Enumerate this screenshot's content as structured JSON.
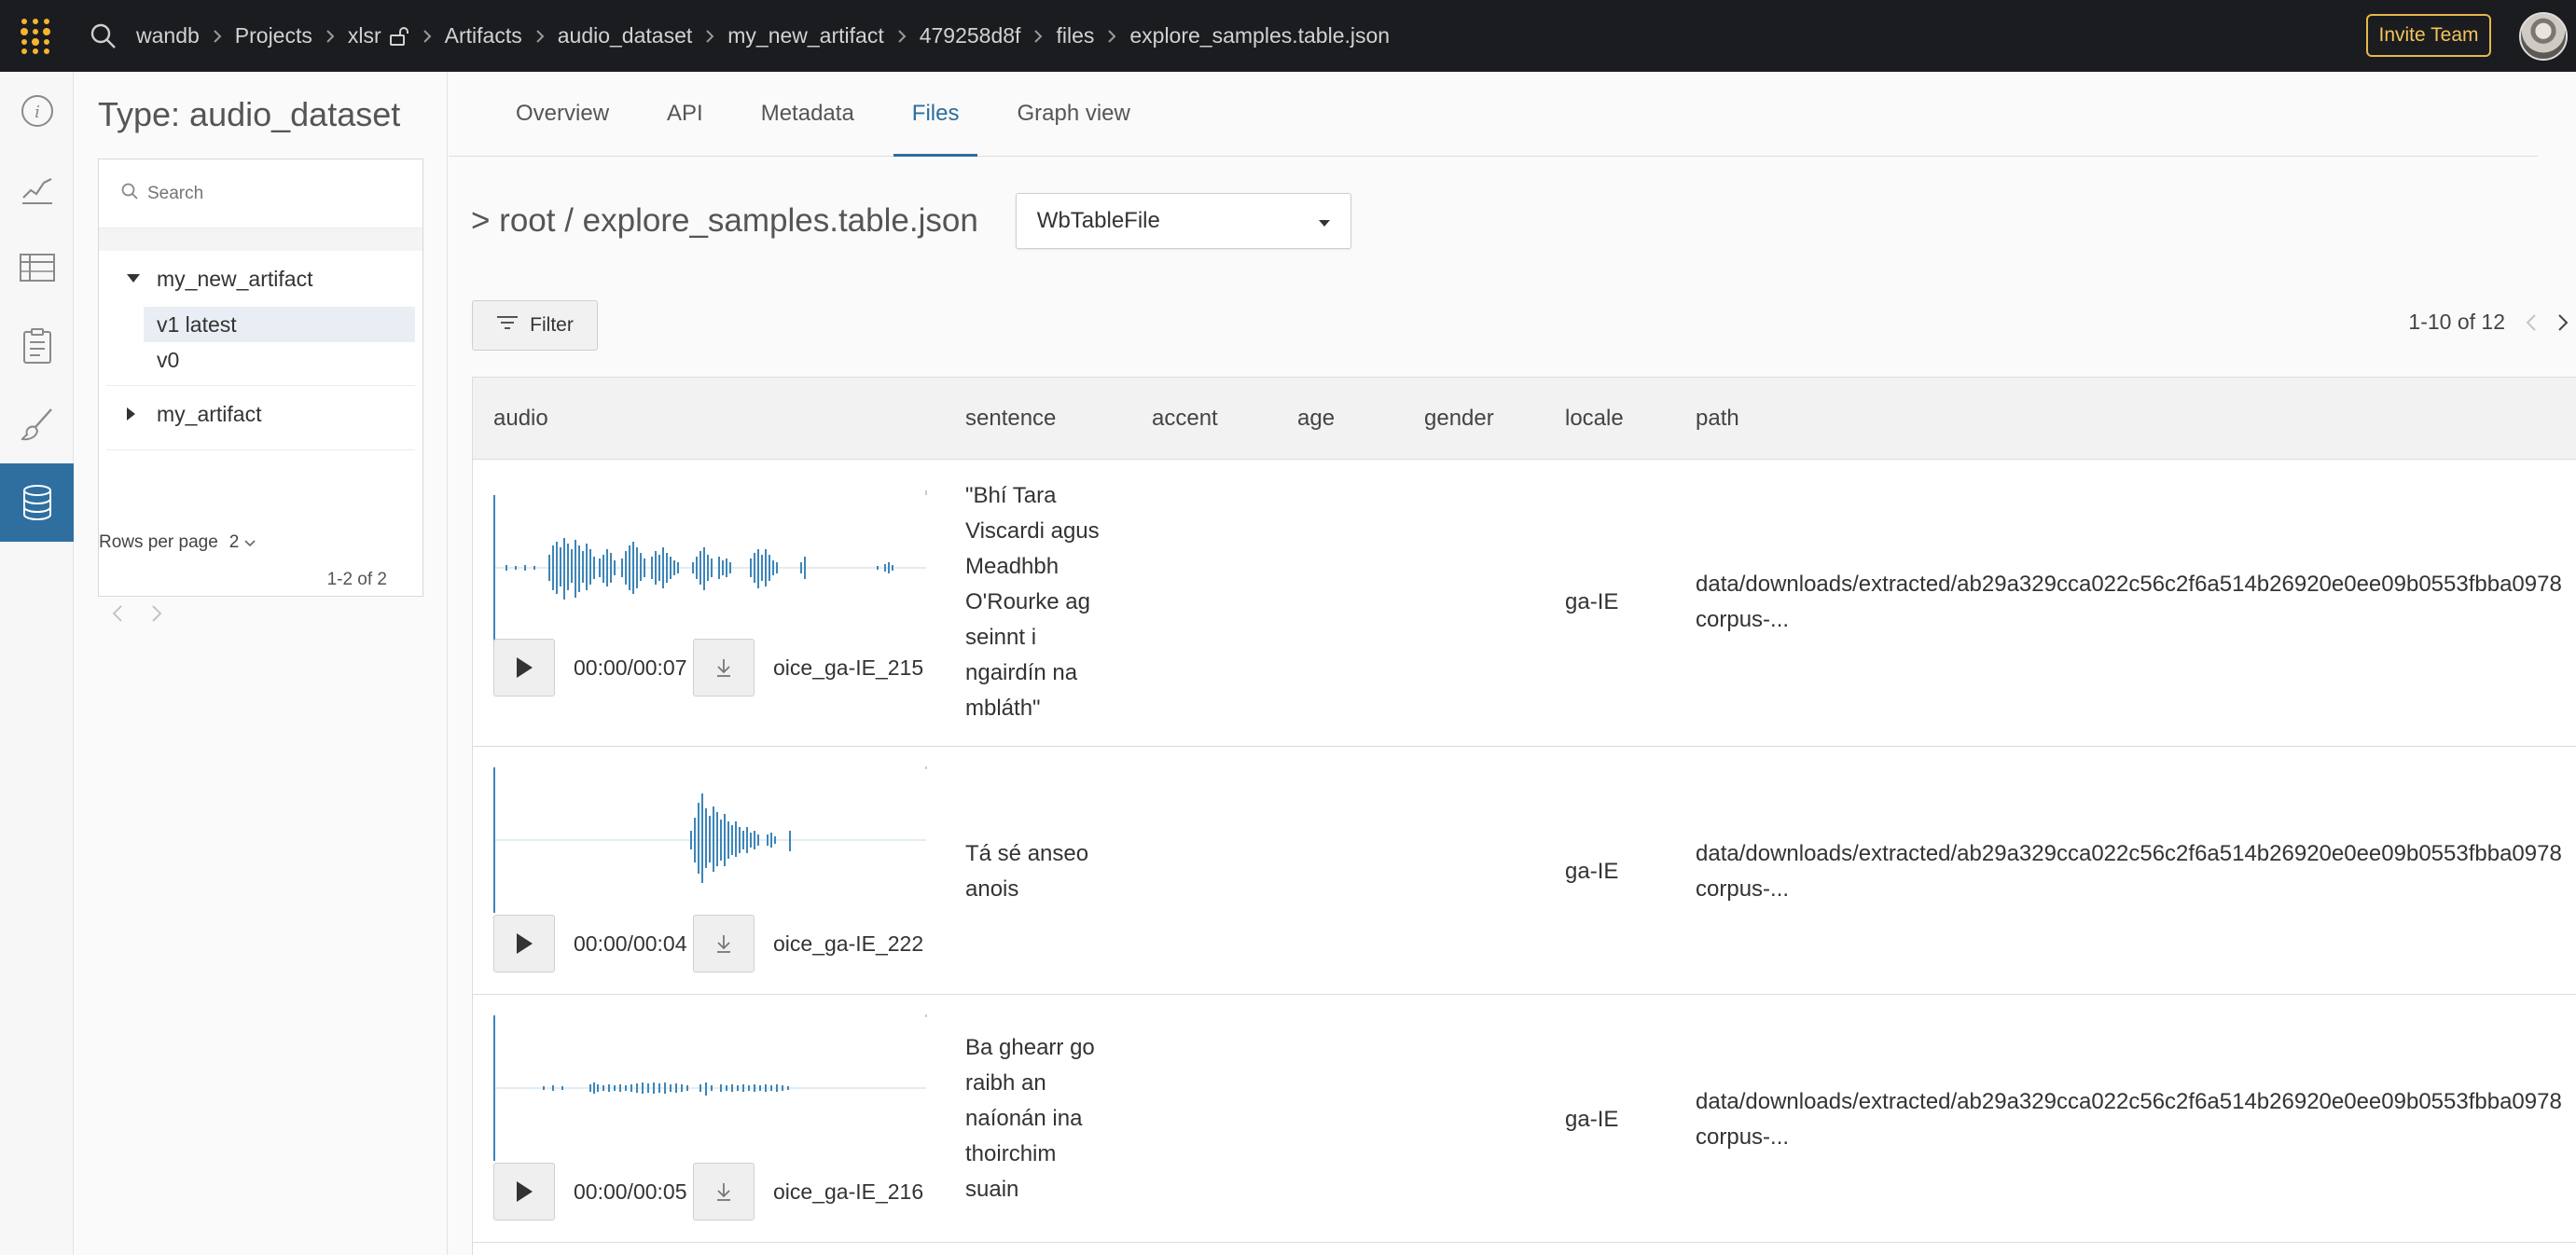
{
  "topbar": {
    "breadcrumb": [
      "wandb",
      "Projects",
      "xlsr",
      "Artifacts",
      "audio_dataset",
      "my_new_artifact",
      "479258d8f",
      "files",
      "explore_samples.table.json"
    ],
    "invite_label": "Invite Team",
    "accent_color": "#e8b64b"
  },
  "leftnav": {
    "items": [
      "info-icon",
      "chart-icon",
      "table-icon",
      "report-icon",
      "brush-icon",
      "database-icon"
    ],
    "active_color": "#2f6fa0"
  },
  "side": {
    "title": "Type: audio_dataset",
    "search_placeholder": "Search",
    "artifacts": [
      {
        "name": "my_new_artifact",
        "expanded": true,
        "versions": [
          "v1 latest",
          "v0"
        ]
      },
      {
        "name": "my_artifact",
        "expanded": false,
        "versions": []
      }
    ],
    "rows_per_page_label": "Rows per page",
    "rows_per_page_value": "2",
    "count_label": "1-2 of 2"
  },
  "main": {
    "tabs": [
      "Overview",
      "API",
      "Metadata",
      "Files",
      "Graph view"
    ],
    "active_tab": "Files",
    "path_label": "> root / explore_samples.table.json",
    "type_select": "WbTableFile",
    "filter_label": "Filter",
    "pagination_label": "1-10 of 12",
    "table": {
      "columns": [
        "audio",
        "sentence",
        "accent",
        "age",
        "gender",
        "locale",
        "path"
      ],
      "rows": [
        {
          "audio_time": "00:00/00:07",
          "audio_name": "oice_ga-IE_215",
          "sentence_lines": [
            "\"Bhí Tara",
            "Viscardi agus",
            "Meadhbh",
            "O'Rourke ag",
            "seinnt i",
            "ngairdín na",
            "mbláth\""
          ],
          "accent": "",
          "age": "",
          "gender": "",
          "locale": "ga-IE",
          "path_lines": [
            "data/downloads/extracted/ab29a329cca022c56c2f6a514b26920e0ee09b0553fbba0978",
            "corpus-..."
          ]
        },
        {
          "audio_time": "00:00/00:04",
          "audio_name": "oice_ga-IE_222",
          "sentence_lines": [
            "Tá sé anseo",
            "anois"
          ],
          "accent": "",
          "age": "",
          "gender": "",
          "locale": "ga-IE",
          "path_lines": [
            "data/downloads/extracted/ab29a329cca022c56c2f6a514b26920e0ee09b0553fbba0978",
            "corpus-..."
          ]
        },
        {
          "audio_time": "00:00/00:05",
          "audio_name": "oice_ga-IE_216",
          "sentence_lines": [
            "Ba ghearr go",
            "raibh an",
            "naíonán ina",
            "thoirchim",
            "suain"
          ],
          "accent": "",
          "age": "",
          "gender": "",
          "locale": "ga-IE",
          "path_lines": [
            "data/downloads/extracted/ab29a329cca022c56c2f6a514b26920e0ee09b0553fbba0978",
            "corpus-..."
          ]
        }
      ]
    },
    "waveform_color": "#3d85b8"
  }
}
